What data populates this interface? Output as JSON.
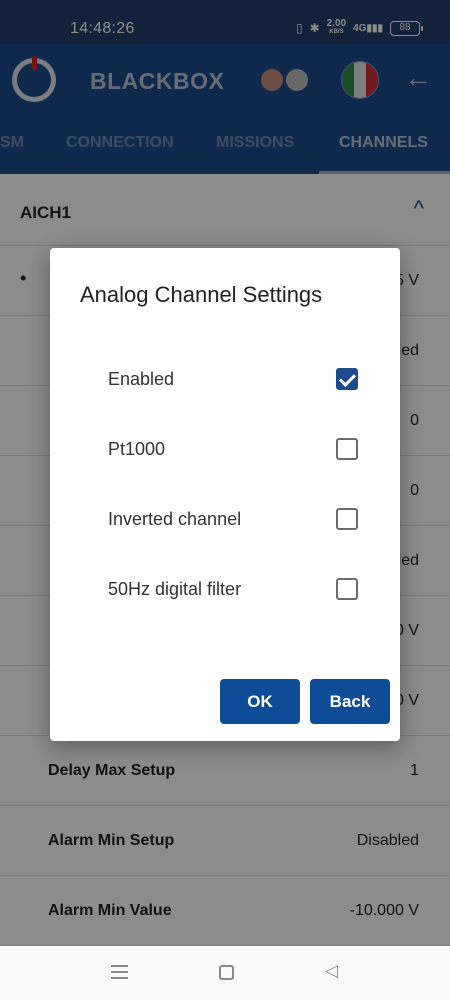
{
  "status_bar": {
    "time": "14:48:26",
    "network_speed": "2.00",
    "network_unit": "KB/S",
    "signal_label": "4G",
    "battery": "88"
  },
  "app_bar": {
    "title": "BLACKBOX",
    "status_dot_colors": [
      "#c58f7f",
      "#bdbdbd"
    ],
    "flag_colors": [
      "#2c8f47",
      "#e7e7e7",
      "#cf2f35"
    ],
    "back_icon": "arrow-left-icon"
  },
  "tabs": [
    {
      "label": "SM",
      "active": false
    },
    {
      "label": "CONNECTION",
      "active": false
    },
    {
      "label": "MISSIONS",
      "active": false
    },
    {
      "label": "CHANNELS",
      "active": true
    }
  ],
  "section": {
    "title": "AICH1",
    "chevron": "^"
  },
  "rows": [
    {
      "label": "",
      "value": "5 V",
      "bullet": "•"
    },
    {
      "label": "",
      "value": "led",
      "bullet": ""
    },
    {
      "label": "",
      "value": "0",
      "bullet": ""
    },
    {
      "label": "",
      "value": "0",
      "bullet": ""
    },
    {
      "label": "",
      "value": "led",
      "bullet": ""
    },
    {
      "label": "",
      "value": "0 V",
      "bullet": ""
    },
    {
      "label": "",
      "value": "0 V",
      "bullet": ""
    },
    {
      "label": "Delay Max Setup",
      "value": "1",
      "bullet": ""
    },
    {
      "label": "Alarm Min Setup",
      "value": "Disabled",
      "bullet": ""
    },
    {
      "label": "Alarm Min Value",
      "value": "-10.000 V",
      "bullet": ""
    }
  ],
  "dialog": {
    "title": "Analog Channel Settings",
    "options": [
      {
        "label": "Enabled",
        "checked": true
      },
      {
        "label": "Pt1000",
        "checked": false
      },
      {
        "label": "Inverted channel",
        "checked": false
      },
      {
        "label": "50Hz digital filter",
        "checked": false
      }
    ],
    "ok_label": "OK",
    "back_label": "Back"
  },
  "colors": {
    "primary": "#1d4b8b",
    "button": "#0f4c97",
    "status_bar": "#1f3f6a"
  }
}
